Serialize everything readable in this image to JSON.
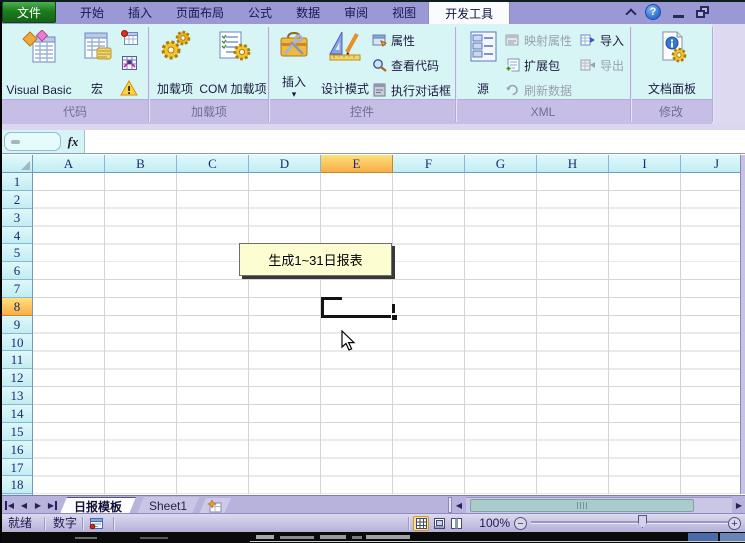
{
  "tab_bar": {
    "file_tab": "文件",
    "tabs": [
      "开始",
      "插入",
      "页面布局",
      "公式",
      "数据",
      "审阅",
      "视图",
      "开发工具"
    ],
    "active_tab": "开发工具"
  },
  "ribbon": {
    "code_group": {
      "label": "代码",
      "visual_basic": "Visual Basic",
      "macros": "宏"
    },
    "addins_group": {
      "label": "加载项",
      "addins": "加载项",
      "com_addins": "COM 加载项"
    },
    "controls_group": {
      "label": "控件",
      "insert": "插入",
      "design_mode": "设计模式",
      "properties": "属性",
      "view_code": "查看代码",
      "run_dialog": "执行对话框"
    },
    "xml_group": {
      "label": "XML",
      "source": "源",
      "map_properties": "映射属性",
      "expansion_packs": "扩展包",
      "refresh_data": "刷新数据",
      "import": "导入",
      "export": "导出"
    },
    "modify_group": {
      "label": "修改",
      "document_panel": "文档面板"
    }
  },
  "formula_bar": {
    "fx_label": "fx",
    "name_box_value": "",
    "formula_value": ""
  },
  "grid": {
    "columns": [
      "A",
      "B",
      "C",
      "D",
      "E",
      "F",
      "G",
      "H",
      "I",
      "J"
    ],
    "rows": [
      "1",
      "2",
      "3",
      "4",
      "5",
      "6",
      "7",
      "8",
      "9",
      "10",
      "11",
      "12",
      "13",
      "14",
      "15",
      "16",
      "17",
      "18"
    ],
    "selected_column": "E",
    "selected_row": "8"
  },
  "form_button": {
    "label": "生成1~31日报表"
  },
  "sheet_tab_bar": {
    "tabs": [
      {
        "label": "日报模板",
        "active": true
      },
      {
        "label": "Sheet1",
        "active": false
      }
    ]
  },
  "status_bar": {
    "ready_label": "就绪",
    "numlock_label": "数字",
    "zoom_level": "100%"
  },
  "icons": {
    "dropdown_arrow": "▾",
    "tab_first": "◀",
    "tab_prev": "◀",
    "tab_next": "▶",
    "tab_last": "▶",
    "scroll_left": "◀",
    "scroll_right": "▶",
    "zoom_out": "−",
    "zoom_in": "+",
    "help": "?"
  },
  "colors": {
    "tab_bar_bg": "#9b98d6",
    "file_tab_green": "#1d7c1d",
    "ribbon_bg": "#d8f5f6",
    "group_label_bg": "#c7bee6",
    "header_bg": "#c9f0f5",
    "selected_header_orange": "#f8ae49",
    "status_bar_bg": "#c7c4e6",
    "form_button_fill": "#fdfdd2",
    "grid_line": "#d6d6d6"
  }
}
